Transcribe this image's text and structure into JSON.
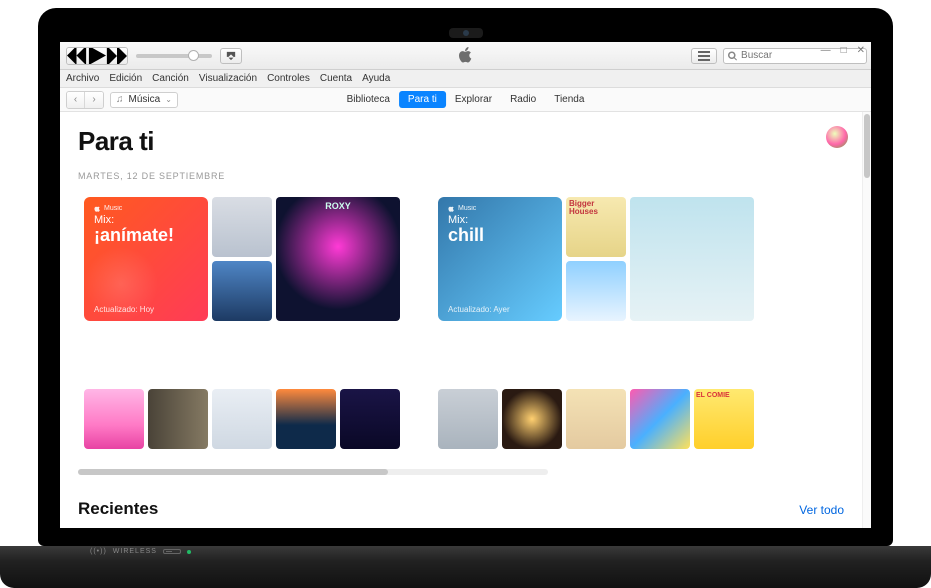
{
  "menubar": [
    "Archivo",
    "Edición",
    "Canción",
    "Visualización",
    "Controles",
    "Cuenta",
    "Ayuda"
  ],
  "search": {
    "placeholder": "Buscar"
  },
  "dropdown": {
    "label": "Música"
  },
  "tabs": [
    {
      "label": "Biblioteca",
      "active": false
    },
    {
      "label": "Para ti",
      "active": true
    },
    {
      "label": "Explorar",
      "active": false
    },
    {
      "label": "Radio",
      "active": false
    },
    {
      "label": "Tienda",
      "active": false
    }
  ],
  "page": {
    "title": "Para ti",
    "date": "MARTES, 12 DE SEPTIEMBRE"
  },
  "mixes": [
    {
      "brand": "Music",
      "mix_label": "Mix:",
      "name": "¡anímate!",
      "updated": "Actualizado: Hoy"
    },
    {
      "brand": "Music",
      "mix_label": "Mix:",
      "name": "chill",
      "updated": "Actualizado: Ayer"
    }
  ],
  "sections": {
    "recent": {
      "title": "Recientes",
      "see_all": "Ver todo"
    }
  },
  "laptop": {
    "wireless": "WIRELESS"
  }
}
